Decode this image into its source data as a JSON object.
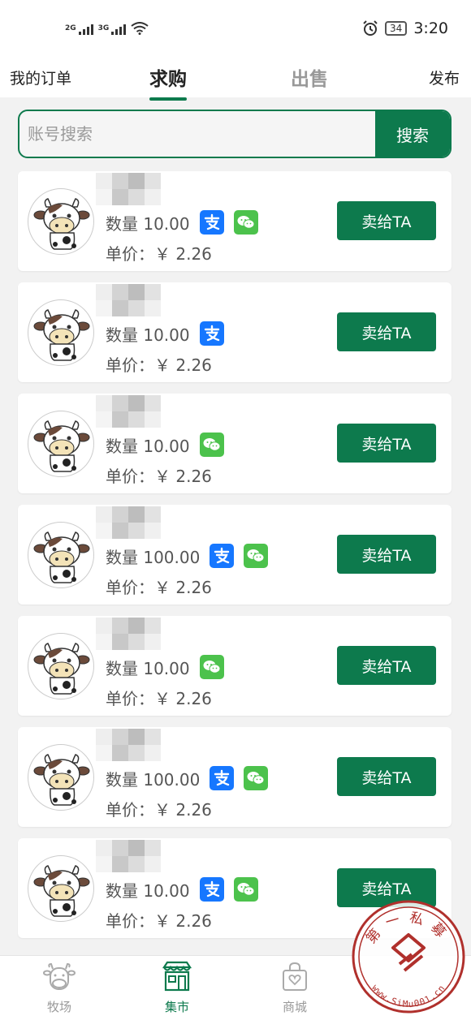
{
  "status_bar": {
    "signal1": "2G",
    "signal2": "3G",
    "battery": "34",
    "time": "3:20"
  },
  "nav": {
    "my_orders": "我的订单",
    "tab_buy": "求购",
    "tab_sell": "出售",
    "publish": "发布"
  },
  "search": {
    "placeholder": "账号搜索",
    "button": "搜索"
  },
  "cards": [
    {
      "quantity": "数量 10.00",
      "price": "单价：￥ 2.26",
      "alipay": true,
      "wechat": true,
      "button": "卖给TA"
    },
    {
      "quantity": "数量 10.00",
      "price": "单价：￥ 2.26",
      "alipay": true,
      "wechat": false,
      "button": "卖给TA"
    },
    {
      "quantity": "数量 10.00",
      "price": "单价：￥ 2.26",
      "alipay": false,
      "wechat": true,
      "button": "卖给TA"
    },
    {
      "quantity": "数量 100.00",
      "price": "单价：￥ 2.26",
      "alipay": true,
      "wechat": true,
      "button": "卖给TA"
    },
    {
      "quantity": "数量 10.00",
      "price": "单价：￥ 2.26",
      "alipay": false,
      "wechat": true,
      "button": "卖给TA"
    },
    {
      "quantity": "数量 100.00",
      "price": "单价：￥ 2.26",
      "alipay": true,
      "wechat": true,
      "button": "卖给TA"
    },
    {
      "quantity": "数量 10.00",
      "price": "单价：￥ 2.26",
      "alipay": true,
      "wechat": true,
      "button": "卖给TA"
    }
  ],
  "bottom_nav": {
    "ranch": "牧场",
    "market": "集市",
    "mall": "商城"
  },
  "watermark": {
    "top_text": "第一私募",
    "bottom_text": "www.SiMu001.cn"
  },
  "colors": {
    "brand_green": "#0d7a4d",
    "alipay_blue": "#1677ff",
    "wechat_green": "#4cc24c",
    "seal_red": "#b0302c"
  },
  "icons": {
    "avatar": "cow-icon",
    "alipay": "alipay-icon",
    "wechat": "wechat-icon",
    "ranch": "cow-icon",
    "market": "store-icon",
    "mall": "shopping-bag-icon"
  }
}
